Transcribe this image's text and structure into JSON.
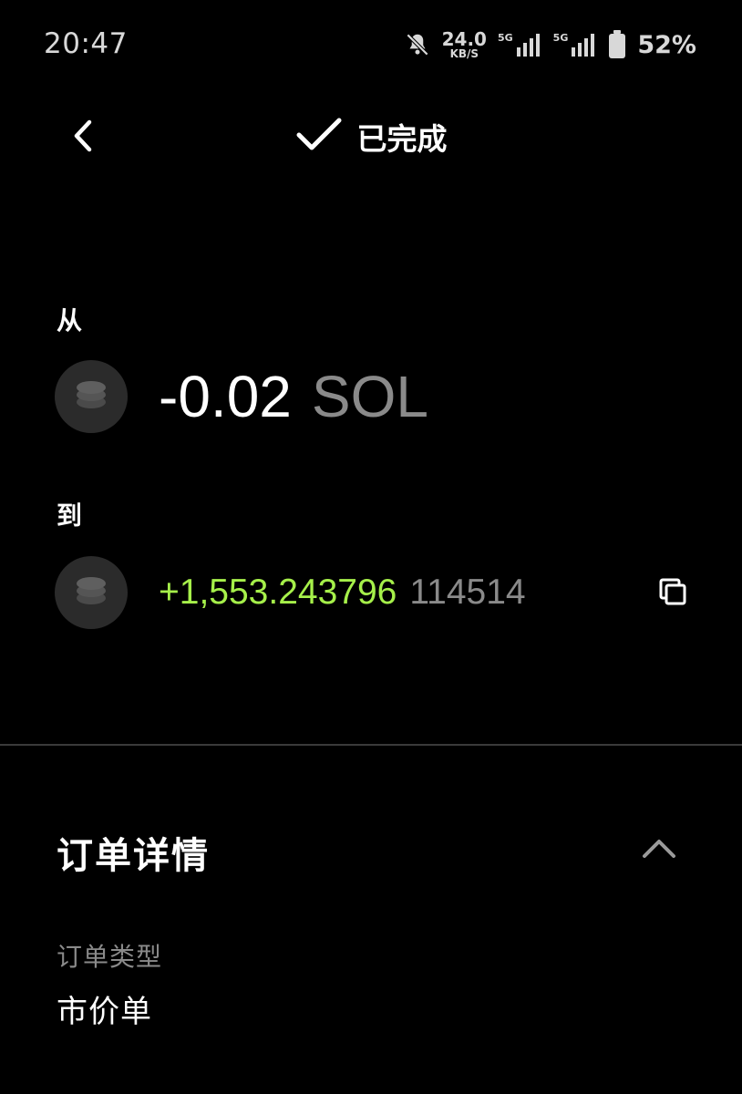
{
  "status_bar": {
    "time": "20:47",
    "net_speed": "24.0",
    "net_speed_unit": "KB/S",
    "signal_1_tag": "5G",
    "signal_2_tag": "5G",
    "battery_pct": "52%"
  },
  "header": {
    "title": "已完成",
    "icons": [
      "back-icon",
      "check-icon"
    ]
  },
  "transfer": {
    "from_label": "从",
    "from_amount": "-0.02",
    "from_symbol": "SOL",
    "to_label": "到",
    "to_amount": "+1,553.243796",
    "to_symbol": "114514",
    "to_amount_color": "#a6f04a"
  },
  "details": {
    "title": "订单详情",
    "order_type_label": "订单类型",
    "order_type_value": "市价单"
  },
  "colors": {
    "background": "#000000",
    "accent_green": "#a6f04a",
    "muted_text": "#8a8a8a",
    "divider": "#3a3a3a"
  }
}
